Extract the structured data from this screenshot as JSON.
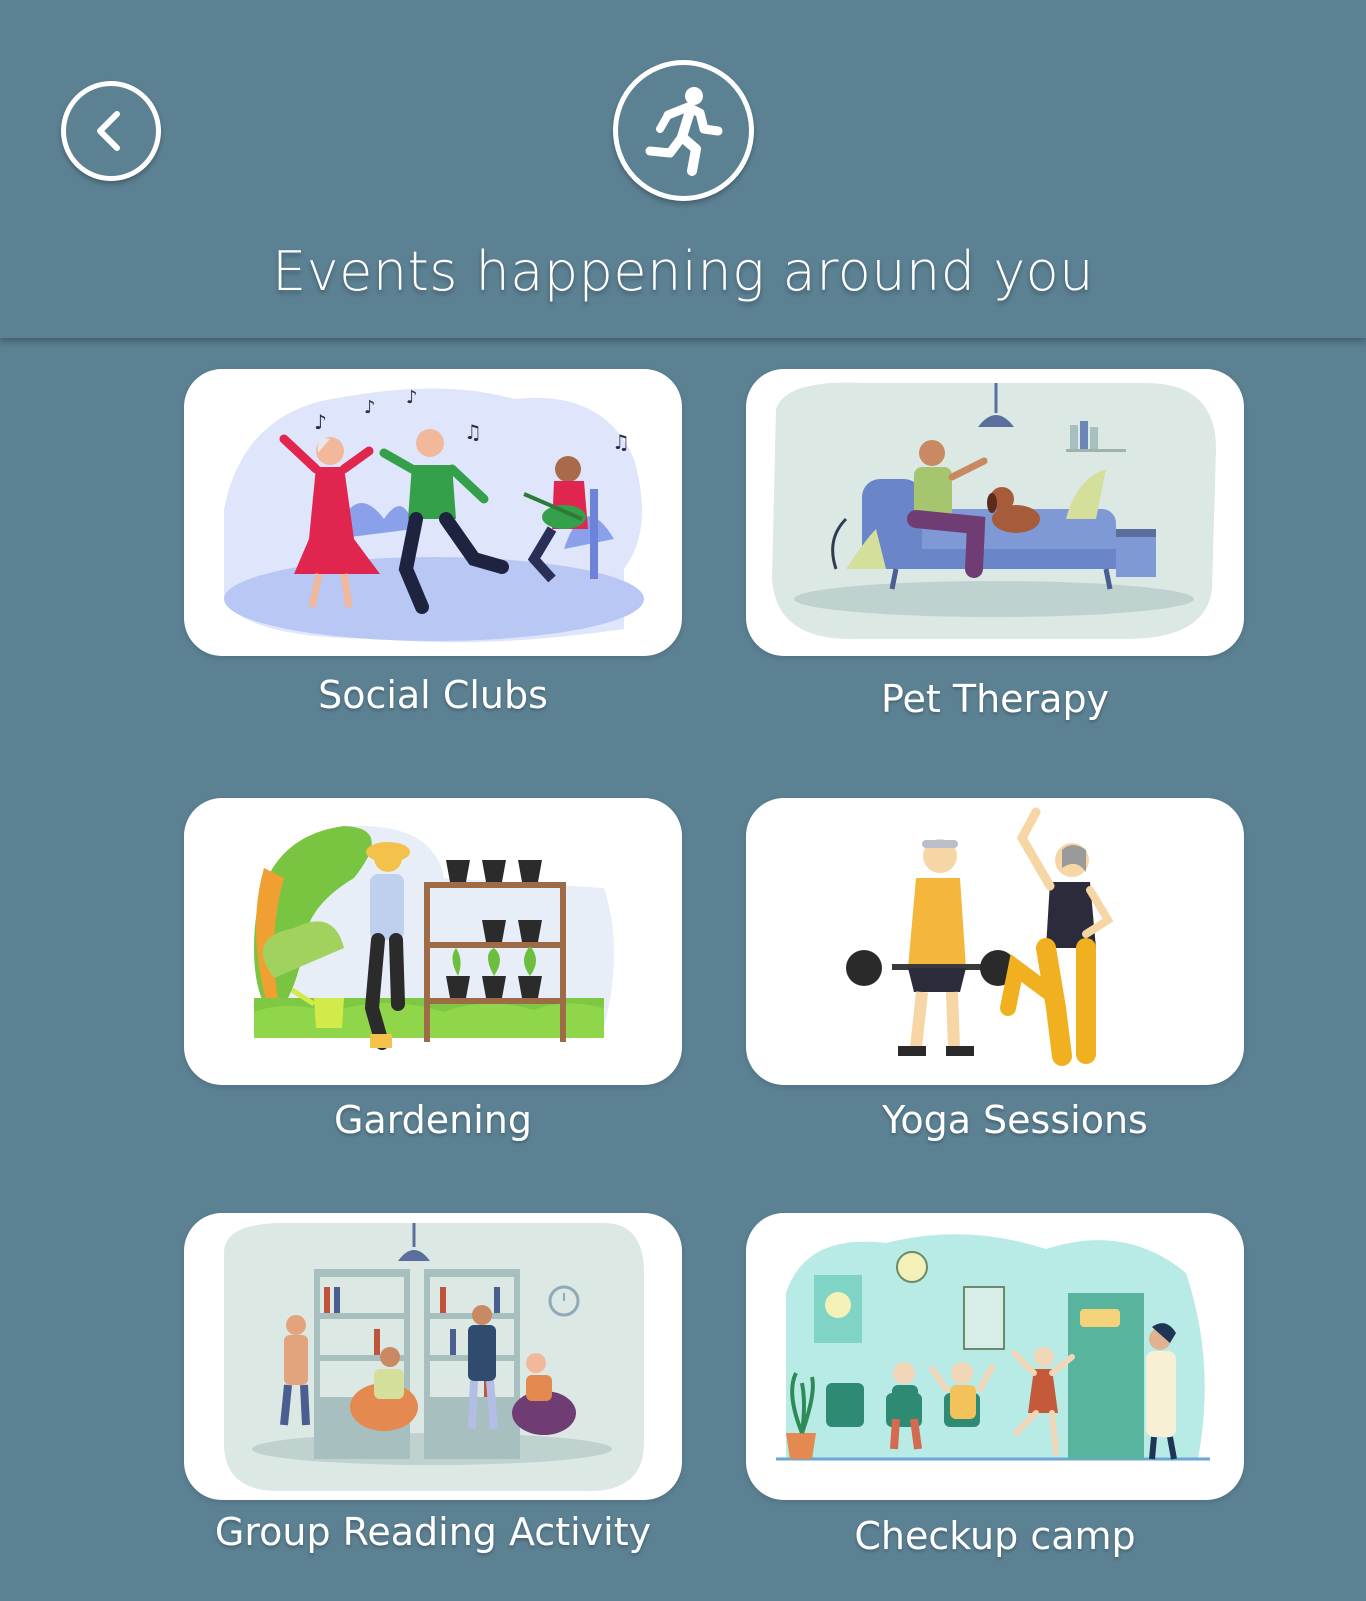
{
  "header": {
    "back_icon": "chevron-left-icon",
    "activity_icon": "running-person-icon",
    "title": "Events happening around you"
  },
  "events": [
    {
      "label": "Social Clubs",
      "illustration": "seniors-dancing-with-guitarist-illustration"
    },
    {
      "label": "Pet Therapy",
      "illustration": "man-on-sofa-with-dog-illustration"
    },
    {
      "label": "Gardening",
      "illustration": "person-potting-plants-on-shelf-illustration"
    },
    {
      "label": "Yoga Sessions",
      "illustration": "seniors-lifting-barbell-and-yoga-pose-illustration"
    },
    {
      "label": "Group Reading Activity",
      "illustration": "people-reading-in-library-illustration"
    },
    {
      "label": "Checkup camp",
      "illustration": "seniors-waiting-at-clinic-illustration"
    }
  ],
  "colors": {
    "background": "#5b8193",
    "card": "#ffffff",
    "text": "#ffffff"
  }
}
